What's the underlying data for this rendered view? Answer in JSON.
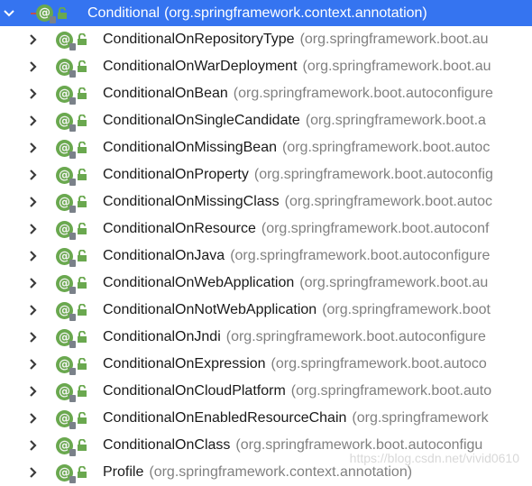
{
  "tree": {
    "root": {
      "name": "Conditional",
      "package": "(org.springframework.context.annotation)"
    },
    "children": [
      {
        "name": "ConditionalOnRepositoryType",
        "package": "(org.springframework.boot.au"
      },
      {
        "name": "ConditionalOnWarDeployment",
        "package": "(org.springframework.boot.au"
      },
      {
        "name": "ConditionalOnBean",
        "package": "(org.springframework.boot.autoconfigure"
      },
      {
        "name": "ConditionalOnSingleCandidate",
        "package": "(org.springframework.boot.a"
      },
      {
        "name": "ConditionalOnMissingBean",
        "package": "(org.springframework.boot.autoc"
      },
      {
        "name": "ConditionalOnProperty",
        "package": "(org.springframework.boot.autoconfig"
      },
      {
        "name": "ConditionalOnMissingClass",
        "package": "(org.springframework.boot.autoc"
      },
      {
        "name": "ConditionalOnResource",
        "package": "(org.springframework.boot.autoconf"
      },
      {
        "name": "ConditionalOnJava",
        "package": "(org.springframework.boot.autoconfigure"
      },
      {
        "name": "ConditionalOnWebApplication",
        "package": "(org.springframework.boot.au"
      },
      {
        "name": "ConditionalOnNotWebApplication",
        "package": "(org.springframework.boot"
      },
      {
        "name": "ConditionalOnJndi",
        "package": "(org.springframework.boot.autoconfigure"
      },
      {
        "name": "ConditionalOnExpression",
        "package": "(org.springframework.boot.autoco"
      },
      {
        "name": "ConditionalOnCloudPlatform",
        "package": "(org.springframework.boot.auto"
      },
      {
        "name": "ConditionalOnEnabledResourceChain",
        "package": "(org.springframework"
      },
      {
        "name": "ConditionalOnClass",
        "package": "(org.springframework.boot.autoconfigu"
      },
      {
        "name": "Profile",
        "package": "(org.springframework.context.annotation)"
      }
    ]
  },
  "icons": {
    "expand": "chevron-down-icon",
    "collapsed": "chevron-right-icon",
    "annotation": "annotation-type-icon",
    "access": "lock-open-icon"
  },
  "colors": {
    "selection": "#3574f0",
    "annotation_icon": "#6aa84f",
    "package_text": "#808080"
  },
  "watermark": "https://blog.csdn.net/vivid0610"
}
